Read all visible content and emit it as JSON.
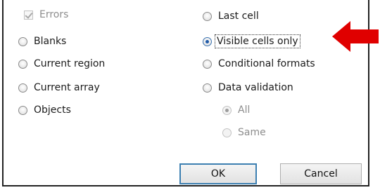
{
  "options_left": [
    {
      "label": "Errors",
      "kind": "checkbox",
      "disabled": true,
      "checked": true
    },
    {
      "label": "Blanks",
      "kind": "radio",
      "selected": false
    },
    {
      "label": "Current region",
      "kind": "radio",
      "selected": false
    },
    {
      "label": "Current array",
      "kind": "radio",
      "selected": false
    },
    {
      "label": "Objects",
      "kind": "radio",
      "selected": false
    }
  ],
  "options_right": [
    {
      "label": "Last cell",
      "kind": "radio",
      "selected": false
    },
    {
      "label": "Visible cells only",
      "kind": "radio",
      "selected": true
    },
    {
      "label": "Conditional formats",
      "kind": "radio",
      "selected": false
    },
    {
      "label": "Data validation",
      "kind": "radio",
      "selected": false
    }
  ],
  "validation_sub": [
    {
      "label": "All",
      "selected": true,
      "disabled": true
    },
    {
      "label": "Same",
      "selected": false,
      "disabled": true
    }
  ],
  "buttons": {
    "ok": "OK",
    "cancel": "Cancel"
  },
  "annotation": {
    "arrow_color": "#e00000"
  }
}
